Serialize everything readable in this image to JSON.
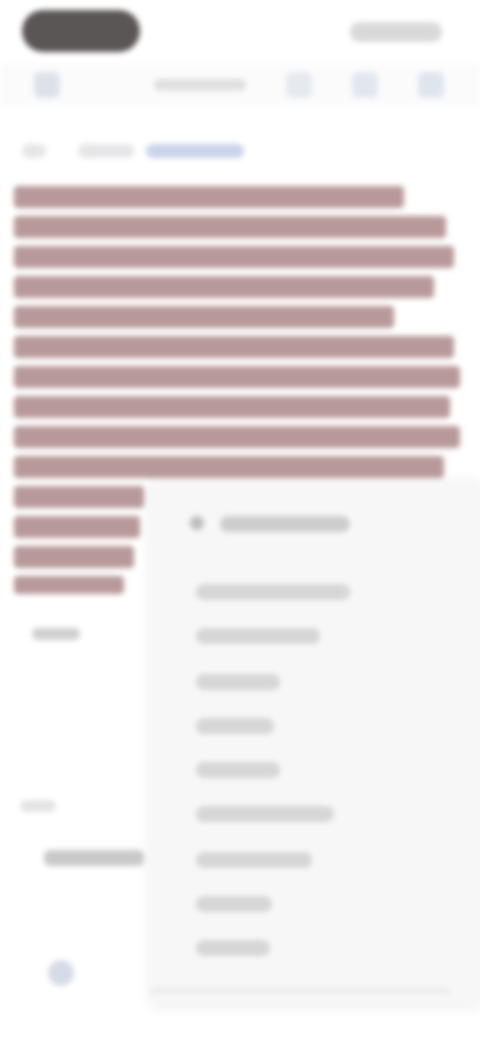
{
  "status_bar": {
    "pill_label": "",
    "right_label": ""
  },
  "toolbar": {
    "tab_title": "",
    "icons": [
      "menu-icon",
      "share-icon",
      "bookmark-icon",
      "more-icon"
    ]
  },
  "breadcrumb": {
    "items": [
      "",
      ""
    ]
  },
  "content": {
    "highlighted_paragraph": ""
  },
  "sidebar": {
    "labels": [
      "",
      ""
    ]
  },
  "menu": {
    "header": "",
    "items": [
      "",
      "",
      "",
      "",
      "",
      "",
      "",
      "",
      ""
    ]
  },
  "colors": {
    "highlight": "#b89999",
    "menu_bg": "#f7f7f8"
  }
}
